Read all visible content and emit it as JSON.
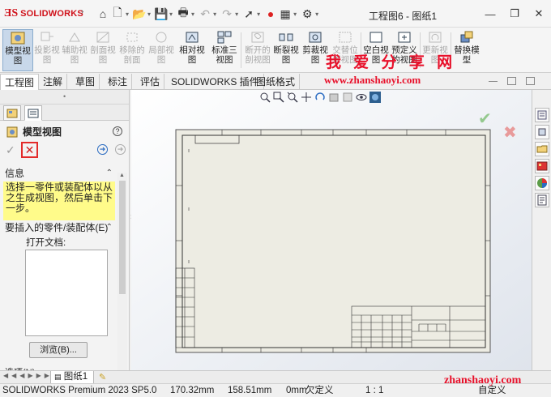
{
  "app": {
    "brand": "SOLIDWORKS",
    "window_title": "工程图6 - 图纸1"
  },
  "ribbon": {
    "buttons": [
      {
        "label1": "模型视",
        "label2": "图"
      },
      {
        "label1": "投影视",
        "label2": "图"
      },
      {
        "label1": "辅助视",
        "label2": "图"
      },
      {
        "label1": "剖面视",
        "label2": "图"
      },
      {
        "label1": "移除的",
        "label2": "剖面"
      },
      {
        "label1": "局部视",
        "label2": "图"
      },
      {
        "label1": "相对视",
        "label2": "图"
      },
      {
        "label1": "标准三",
        "label2": "视图"
      },
      {
        "label1": "断开的",
        "label2": "剖视图"
      },
      {
        "label1": "断裂视",
        "label2": "图"
      },
      {
        "label1": "剪裁视",
        "label2": "图"
      },
      {
        "label1": "交替位",
        "label2": "置视图"
      },
      {
        "label1": "空白视",
        "label2": "图"
      },
      {
        "label1": "预定义",
        "label2": "的视图"
      },
      {
        "label1": "更新视",
        "label2": "图"
      },
      {
        "label1": "替换模",
        "label2": "型"
      }
    ]
  },
  "watermark": {
    "text_cn": "我 爱 分 享 网",
    "url": "www.zhanshaoyi.com",
    "url_bottom": "zhanshaoyi.com"
  },
  "tabs": [
    "工程图",
    "注解",
    "草图",
    "标注",
    "评估",
    "SOLIDWORKS 插件",
    "图纸格式"
  ],
  "property_manager": {
    "title": "模型视图",
    "help": "?",
    "ok_symbol": "✓",
    "cancel_symbol": "✕",
    "info_header": "信息",
    "info_text": "选择一零件或装配体以从之生成视图，然后单击下一步。",
    "part_section": "要插入的零件/装配体(E)",
    "open_doc_label": "打开文档:",
    "browse_label": "浏览(B)...",
    "options_header": "选项(N)"
  },
  "sheet_tab": "图纸1",
  "status": {
    "product": "SOLIDWORKS Premium 2023 SP5.0",
    "x": "170.32mm",
    "y": "158.51mm",
    "z": "0mm",
    "state": "欠定义",
    "scale": "1 : 1",
    "state2": "自定义"
  }
}
